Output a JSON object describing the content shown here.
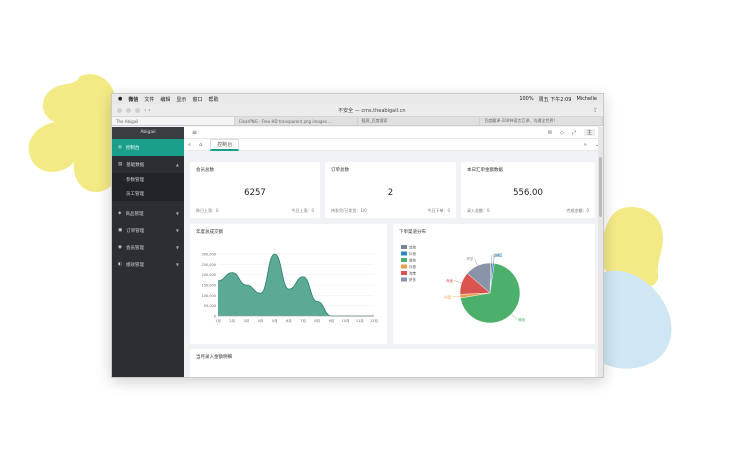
{
  "mac_menu": {
    "apple": "",
    "app": "微信",
    "items": [
      "文件",
      "编辑",
      "显示",
      "窗口",
      "帮助"
    ],
    "battery": "100%",
    "datetime": "周五 下午2:09",
    "user": "Michelle"
  },
  "browser": {
    "url": "不安全 — cms.theabigail.cn",
    "tabs": [
      "The Abigail",
      "ClearPNG - Free HD transparent png images ...",
      "截屏_百度搜索",
      "百度翻译-200种语言互译、沟通全世界！"
    ]
  },
  "sidebar": {
    "logo": "Abigail",
    "items": [
      {
        "label": "控制台",
        "icon": "dashboard-icon",
        "active": true
      },
      {
        "label": "基础数据",
        "icon": "data-icon",
        "open": true
      },
      {
        "label": "参数管理",
        "sub": true
      },
      {
        "label": "员工管理",
        "sub": true
      },
      {
        "label": "商品管理",
        "icon": "goods-icon"
      },
      {
        "label": "订单管理",
        "icon": "order-icon"
      },
      {
        "label": "会员管理",
        "icon": "member-icon"
      },
      {
        "label": "绩效管理",
        "icon": "performance-icon"
      }
    ]
  },
  "topbar": {
    "menu_icon": "≡",
    "user": "主"
  },
  "tabbar": {
    "current": "控制台"
  },
  "cards": [
    {
      "title": "会员总数",
      "value": "6257",
      "left": "昨日上涨：0",
      "right": "今日上涨：0"
    },
    {
      "title": "订单总数",
      "value": "2",
      "left": "待发货/已发货：1/0",
      "right": "今日下单：0"
    },
    {
      "title": "本日汇单金额数据",
      "value": "556.00",
      "left": "录入金额：0",
      "right": "完成金额：0"
    }
  ],
  "area_chart": {
    "title": "年度总成交额"
  },
  "pie_chart": {
    "title": "下单渠道分布"
  },
  "bottom": {
    "title": "当月录入金额明细"
  },
  "chart_data": [
    {
      "type": "area",
      "title": "年度总成交额",
      "categories": [
        "1月",
        "2月",
        "3月",
        "4月",
        "5月",
        "6月",
        "7月",
        "8月",
        "9月",
        "10月",
        "11月",
        "12月"
      ],
      "series": [
        {
          "values": [
            170000,
            210000,
            150000,
            110000,
            300000,
            130000,
            190000,
            70000,
            0,
            0,
            0,
            0
          ]
        }
      ],
      "ylim": [
        0,
        300000
      ],
      "yticks": [
        "0",
        "50,000",
        "100,000",
        "150,000",
        "200,000",
        "250,000",
        "300,000"
      ],
      "color": "#3e9b84"
    },
    {
      "type": "pie",
      "title": "下单渠道分布",
      "slices": [
        {
          "name": "其他",
          "value": 1,
          "color": "#7a8796"
        },
        {
          "name": "抖音",
          "value": 1,
          "color": "#2e86c1"
        },
        {
          "name": "微信",
          "value": 70,
          "color": "#4caf6a"
        },
        {
          "name": "抖音",
          "value": 2,
          "color": "#e8a04a"
        },
        {
          "name": "淘宝",
          "value": 12,
          "color": "#d9534f"
        },
        {
          "name": "拼多",
          "value": 14,
          "color": "#8a93a8"
        }
      ],
      "legend": [
        "其他",
        "抖音",
        "微信",
        "抖音",
        "淘宝",
        "拼多"
      ],
      "slice_labels": [
        "其他",
        "抖音",
        "微信",
        "抖音",
        "淘宝",
        "拼多"
      ]
    }
  ],
  "colors": {
    "accent": "#1aa08a",
    "sidebar": "#2b2f33"
  }
}
